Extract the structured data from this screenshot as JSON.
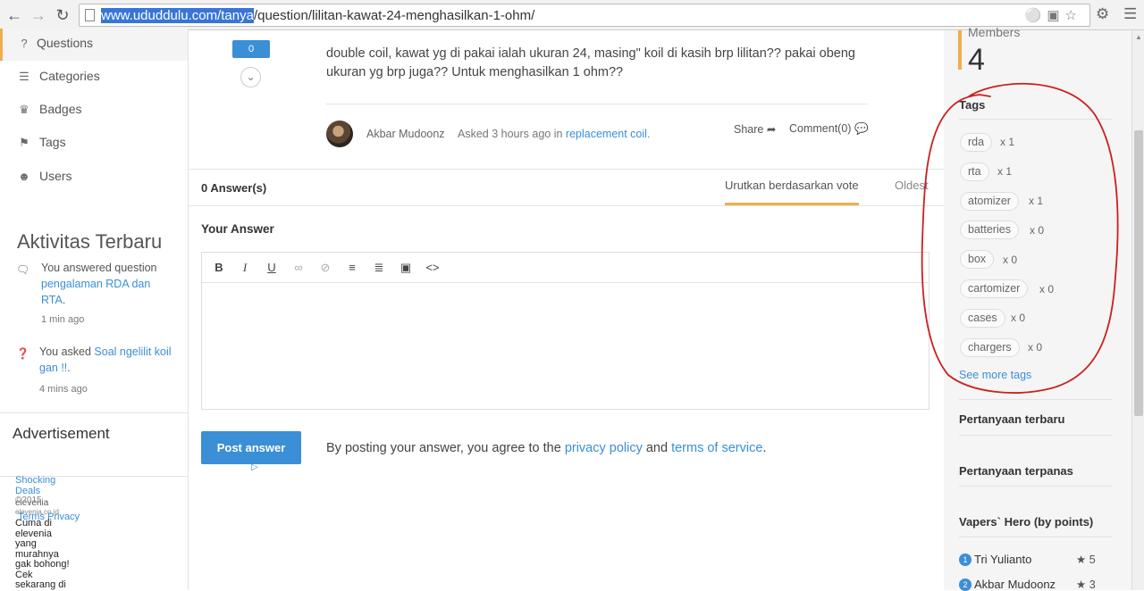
{
  "browser": {
    "url_selected": "www.ududdulu.com/tanya",
    "url_rest": "/question/lilitan-kawat-24-menghasilkan-1-ohm/"
  },
  "sidebar": {
    "items": [
      {
        "label": "Questions",
        "icon": "question-icon",
        "active": true
      },
      {
        "label": "Categories",
        "icon": "list-icon"
      },
      {
        "label": "Badges",
        "icon": "trophy-icon"
      },
      {
        "label": "Tags",
        "icon": "tags-icon"
      },
      {
        "label": "Users",
        "icon": "users-icon"
      }
    ],
    "activity_title": "Aktivitas Terbaru",
    "activities": [
      {
        "prefix": "You answered question ",
        "link": "pengalaman RDA dan RTA",
        "suffix": ".",
        "time": "1 min ago"
      },
      {
        "prefix": "You asked ",
        "link": "Soal ngelilit koil gan !!",
        "suffix": ".",
        "time": "4 mins ago"
      }
    ],
    "ad_title": "Advertisement",
    "ad_lines": {
      "l1": "Shocking",
      "l2": "Deals",
      "l3": "elevenia",
      "l4": "©2015",
      "l5": "elevenia.co.id",
      "l6": "Terms Privacy",
      "l7": "Cuma di",
      "l8": "elevenia",
      "l9": "yang",
      "l10": "murahnya",
      "l11": "gak bohong!",
      "l12": "Cek",
      "l13": "sekarang di"
    }
  },
  "question": {
    "votes": "0",
    "body": "double coil, kawat yg di pakai ialah ukuran 24, masing\" koil di kasih brp lilitan?? pakai obeng ukuran yg brp juga?? Untuk menghasilkan 1 ohm??",
    "author": "Akbar Mudoonz",
    "asked_prefix": "Asked 3 hours ago in ",
    "category": "replacement coil.",
    "share_label": "Share",
    "comment_label": "Comment(0)"
  },
  "answers": {
    "count_label": "0 Answer(s)",
    "sort_vote": "Urutkan berdasarkan vote",
    "sort_oldest": "Oldest",
    "your_answer": "Your Answer",
    "post_label": "Post answer",
    "terms_prefix": "By posting your answer, you agree to the ",
    "privacy_link": "privacy policy",
    "and": " and ",
    "tos_link": "terms of service",
    "terms_suffix": "."
  },
  "right": {
    "members_label": "Members",
    "members_count": "4",
    "tags_title": "Tags",
    "tags": [
      {
        "name": "rda",
        "count": "x 1"
      },
      {
        "name": "rta",
        "count": "x 1"
      },
      {
        "name": "atomizer",
        "count": "x 1"
      },
      {
        "name": "batteries",
        "count": "x 0"
      },
      {
        "name": "box",
        "count": "x 0"
      },
      {
        "name": "cartomizer",
        "count": "x 0"
      },
      {
        "name": "cases",
        "count": "x 0"
      },
      {
        "name": "chargers",
        "count": "x 0"
      }
    ],
    "see_more": "See more tags",
    "latest": "Pertanyaan terbaru",
    "hottest": "Pertanyaan terpanas",
    "hero_title": "Vapers` Hero (by points)",
    "heroes": [
      {
        "rank": "1",
        "name": "Tri Yulianto",
        "points": "5"
      },
      {
        "rank": "2",
        "name": "Akbar Mudoonz",
        "points": "3"
      }
    ]
  },
  "colors": {
    "accent": "#3a8fd6",
    "highlight": "#f0ad4e",
    "annotation": "#cc1f1f"
  }
}
